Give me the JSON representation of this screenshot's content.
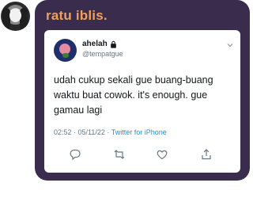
{
  "chat": {
    "sender": "ratu iblis."
  },
  "tweet": {
    "display_name": "ahelah",
    "handle": "@tempatgue",
    "text": "udah cukup sekali gue buang-buang waktu buat cowok. it's enough. gue gamau lagi",
    "timestamp": "02:52 · 05/11/22 · ",
    "source": "Twitter for iPhone"
  },
  "colors": {
    "bubble_bg": "#3a2c4d",
    "sender_name": "#f0a05a",
    "link": "#1b95e0"
  },
  "icons": [
    "lock-icon",
    "chevron-down-icon",
    "reply-icon",
    "retweet-icon",
    "like-icon",
    "share-icon"
  ]
}
